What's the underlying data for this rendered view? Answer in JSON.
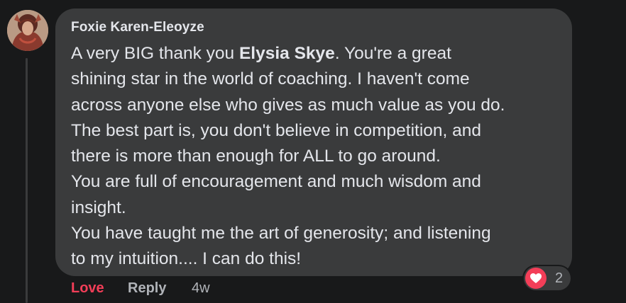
{
  "comment": {
    "author": "Foxie Karen-Eleoyze",
    "lines": [
      {
        "pre": "A very BIG thank you ",
        "bold": "Elysia Skye",
        "post": ". You're a great"
      },
      {
        "text": "shining star in the world of coaching. I haven't come"
      },
      {
        "text": "across anyone else who gives as much value as you do."
      },
      {
        "text": "The best part is, you don't believe in competition, and"
      },
      {
        "text": "there is more than enough for ALL to go around."
      },
      {
        "text": "You are full of encouragement and much wisdom and"
      },
      {
        "text": "insight."
      },
      {
        "text": "You have taught me the art of generosity; and listening"
      },
      {
        "text": "to my intuition.... I can do this!"
      }
    ],
    "reaction": {
      "icon": "heart-icon",
      "count": "2",
      "color": "#f33e58"
    },
    "actions": {
      "love_label": "Love",
      "reply_label": "Reply",
      "timestamp": "4w"
    }
  },
  "colors": {
    "background": "#18191a",
    "bubble": "#3a3b3c",
    "text": "#e4e6eb",
    "secondary_text": "#b0b3b8",
    "love": "#f33e58"
  }
}
